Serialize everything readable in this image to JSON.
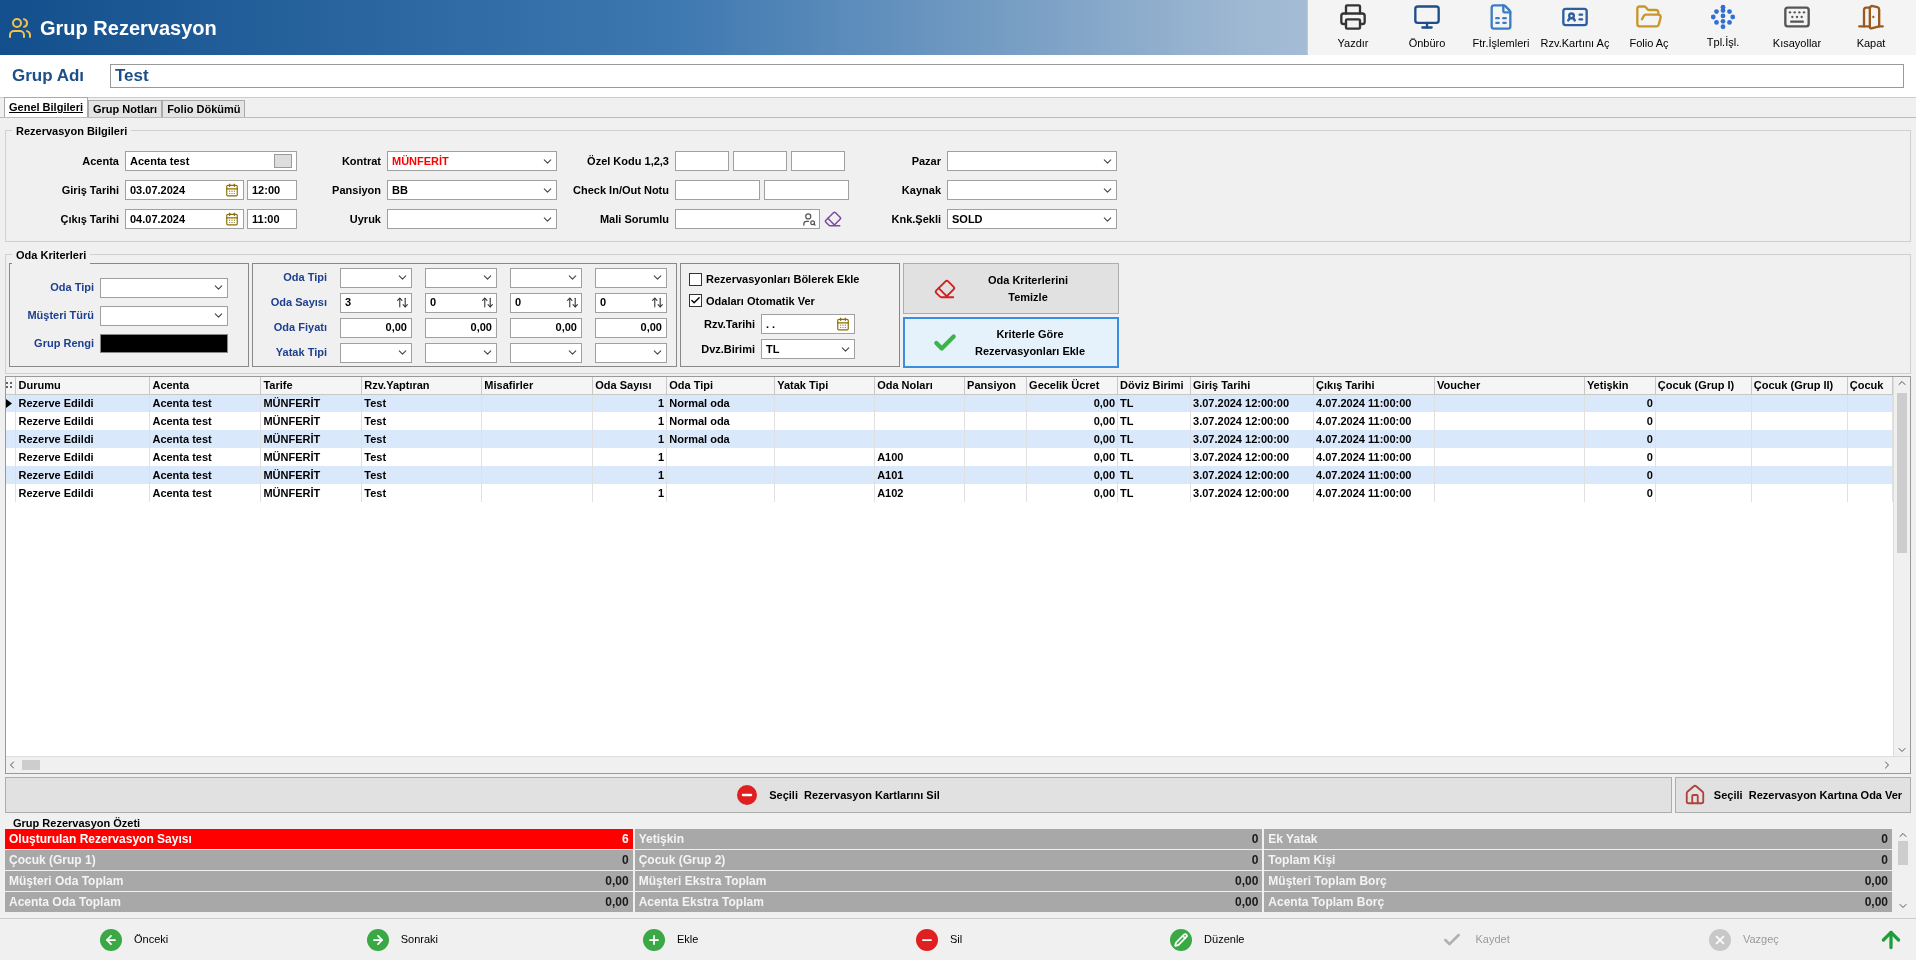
{
  "window": {
    "title": "Grup Rezervasyon"
  },
  "toolbar": [
    {
      "label": "Yazdır"
    },
    {
      "label": "Önbüro"
    },
    {
      "label": "Ftr.İşlemleri"
    },
    {
      "label": "Rzv.Kartını Aç"
    },
    {
      "label": "Folio Aç"
    },
    {
      "label": "Tpl.İşl."
    },
    {
      "label": "Kısayollar"
    },
    {
      "label": "Kapat"
    }
  ],
  "group_name": {
    "label": "Grup Adı",
    "value": "Test"
  },
  "tabs": [
    {
      "label": "Genel Bilgileri",
      "selected": true
    },
    {
      "label": "Grup Notları",
      "selected": false
    },
    {
      "label": "Folio Dökümü",
      "selected": false
    }
  ],
  "reservation_info": {
    "title": "Rezervasyon Bilgileri",
    "columns": [
      [
        {
          "label": "Acenta",
          "kind": "lookup",
          "value": "Acenta test"
        },
        {
          "label": "Giriş Tarihi",
          "kind": "datetime",
          "value": "03.07.2024",
          "time": "12:00"
        },
        {
          "label": "Çıkış Tarihi",
          "kind": "datetime",
          "value": "04.07.2024",
          "time": "11:00"
        }
      ],
      [
        {
          "label": "Kontrat",
          "kind": "select",
          "value": "MÜNFERİT",
          "alert": true
        },
        {
          "label": "Pansiyon",
          "kind": "select",
          "value": "BB",
          "alert": false
        },
        {
          "label": "Uyruk",
          "kind": "select"
        }
      ],
      [
        {
          "label": "Özel Kodu 1,2,3",
          "kind": "triple"
        },
        {
          "label": "Check In/Out Notu",
          "kind": "double"
        },
        {
          "label": "Mali Sorumlu",
          "kind": "person"
        }
      ],
      [
        {
          "label": "Pazar",
          "kind": "select"
        },
        {
          "label": "Kaynak",
          "kind": "select"
        },
        {
          "label": "Knk.Şekli",
          "kind": "select",
          "value": "SOLD",
          "alert": false
        }
      ]
    ]
  },
  "room_criteria": {
    "title": "Oda Kriterleri",
    "left": [
      {
        "label": "Oda Tipi",
        "kind": "select"
      },
      {
        "label": "Müşteri Türü",
        "kind": "select"
      },
      {
        "label": "Grup Rengi",
        "kind": "color",
        "color": "#000000"
      }
    ],
    "grid": [
      {
        "label": "Oda Tipi",
        "cells": [
          {
            "kind": "select"
          },
          {
            "kind": "select"
          },
          {
            "kind": "select"
          },
          {
            "kind": "select"
          }
        ]
      },
      {
        "label": "Oda Sayısı",
        "cells": [
          {
            "kind": "spin",
            "value": "3"
          },
          {
            "kind": "spin",
            "value": "0"
          },
          {
            "kind": "spin",
            "value": "0"
          },
          {
            "kind": "spin",
            "value": "0"
          }
        ]
      },
      {
        "label": "Oda Fiyatı",
        "cells": [
          {
            "kind": "number",
            "value": "0,00"
          },
          {
            "kind": "number",
            "value": "0,00"
          },
          {
            "kind": "number",
            "value": "0,00"
          },
          {
            "kind": "number",
            "value": "0,00"
          }
        ]
      },
      {
        "label": "Yatak Tipi",
        "cells": [
          {
            "kind": "select"
          },
          {
            "kind": "select"
          },
          {
            "kind": "select"
          },
          {
            "kind": "select"
          }
        ]
      }
    ],
    "options": [
      {
        "label": "Rezervasyonları Bölerek Ekle",
        "checked": false
      },
      {
        "label": "Odaları Otomatik Ver",
        "checked": true
      }
    ],
    "fields": [
      {
        "label": "Rzv.Tarihi",
        "kind": "date",
        "value": ". ."
      },
      {
        "label": "Dvz.Birimi",
        "kind": "select",
        "value": "TL"
      }
    ],
    "buttons": [
      {
        "label": "Oda Kriterlerini Temizle",
        "focused": false
      },
      {
        "label": "Kriterle Göre Rezervasyonları Ekle",
        "focused": true
      }
    ]
  },
  "table": {
    "columns": [
      {
        "label": "Durumu",
        "right_aligned": false
      },
      {
        "label": "Acenta",
        "right_aligned": false
      },
      {
        "label": "Tarife",
        "right_aligned": false
      },
      {
        "label": "Rzv.Yaptıran",
        "right_aligned": false
      },
      {
        "label": "Misafirler"
      },
      {
        "label": "Oda Sayısı",
        "right_aligned": true
      },
      {
        "label": "Oda Tipi",
        "right_aligned": false
      },
      {
        "label": "Yatak Tipi"
      },
      {
        "label": "Oda Noları",
        "right_aligned": false
      },
      {
        "label": "Pansiyon"
      },
      {
        "label": "Gecelik Ücret",
        "right_aligned": true
      },
      {
        "label": "Döviz Birimi",
        "right_aligned": false
      },
      {
        "label": "Giriş Tarihi",
        "right_aligned": false
      },
      {
        "label": "Çıkış Tarihi",
        "right_aligned": false
      },
      {
        "label": "Voucher"
      },
      {
        "label": "Yetişkin",
        "right_aligned": true
      },
      {
        "label": "Çocuk (Grup I)"
      },
      {
        "label": "Çocuk (Grup II)"
      },
      {
        "label": "Çocuk"
      }
    ],
    "rows": [
      {
        "selected": true,
        "cells": [
          "Rezerve Edildi",
          "Acenta test",
          "MÜNFERİT",
          "Test",
          null,
          "1",
          "Normal oda",
          null,
          null,
          null,
          "0,00",
          "TL",
          "3.07.2024 12:00:00",
          "4.07.2024 11:00:00",
          null,
          "0",
          null,
          null,
          null
        ]
      },
      {
        "selected": false,
        "cells": [
          "Rezerve Edildi",
          "Acenta test",
          "MÜNFERİT",
          "Test",
          null,
          "1",
          "Normal oda",
          null,
          null,
          null,
          "0,00",
          "TL",
          "3.07.2024 12:00:00",
          "4.07.2024 11:00:00",
          null,
          "0",
          null,
          null,
          null
        ]
      },
      {
        "selected": false,
        "cells": [
          "Rezerve Edildi",
          "Acenta test",
          "MÜNFERİT",
          "Test",
          null,
          "1",
          "Normal oda",
          null,
          null,
          null,
          "0,00",
          "TL",
          "3.07.2024 12:00:00",
          "4.07.2024 11:00:00",
          null,
          "0",
          null,
          null,
          null
        ]
      },
      {
        "selected": false,
        "cells": [
          "Rezerve Edildi",
          "Acenta test",
          "MÜNFERİT",
          "Test",
          null,
          "1",
          null,
          null,
          "A100",
          null,
          "0,00",
          "TL",
          "3.07.2024 12:00:00",
          "4.07.2024 11:00:00",
          null,
          "0",
          null,
          null,
          null
        ]
      },
      {
        "selected": false,
        "cells": [
          "Rezerve Edildi",
          "Acenta test",
          "MÜNFERİT",
          "Test",
          null,
          "1",
          null,
          null,
          "A101",
          null,
          "0,00",
          "TL",
          "3.07.2024 12:00:00",
          "4.07.2024 11:00:00",
          null,
          "0",
          null,
          null,
          null
        ]
      },
      {
        "selected": false,
        "cells": [
          "Rezerve Edildi",
          "Acenta test",
          "MÜNFERİT",
          "Test",
          null,
          "1",
          null,
          null,
          "A102",
          null,
          "0,00",
          "TL",
          "3.07.2024 12:00:00",
          "4.07.2024 11:00:00",
          null,
          "0",
          null,
          null,
          null
        ]
      }
    ]
  },
  "actions": [
    {
      "label": "Seçili  Rezervasyon Kartlarını Sil"
    },
    {
      "label": "Seçili  Rezervasyon Kartına Oda Ver"
    }
  ],
  "summary": {
    "title": "Grup Rezervasyon Özeti",
    "cells": [
      {
        "label": "Oluşturulan Rezervasyon Sayısı",
        "value": "6",
        "alert": true
      },
      {
        "label": "Yetişkin",
        "value": "0",
        "alert": false
      },
      {
        "label": "Ek Yatak",
        "value": "0",
        "alert": false
      },
      {
        "label": "Çocuk (Grup 1)",
        "value": "0",
        "alert": false
      },
      {
        "label": "Çocuk (Grup 2)",
        "value": "0",
        "alert": false
      },
      {
        "label": "Toplam Kişi",
        "value": "0",
        "alert": false
      },
      {
        "label": "Müşteri Oda Toplam",
        "value": "0,00",
        "alert": false
      },
      {
        "label": "Müşteri Ekstra Toplam",
        "value": "0,00",
        "alert": false
      },
      {
        "label": "Müşteri Toplam Borç",
        "value": "0,00",
        "alert": false
      },
      {
        "label": "Acenta Oda Toplam",
        "value": "0,00",
        "alert": false
      },
      {
        "label": "Acenta Ekstra Toplam",
        "value": "0,00",
        "alert": false
      },
      {
        "label": "Acenta Toplam Borç",
        "value": "0,00",
        "alert": false
      }
    ]
  },
  "navigation": [
    {
      "label": "Önceki",
      "disabled": false
    },
    {
      "label": "Sonraki",
      "disabled": false
    },
    {
      "label": "Ekle",
      "disabled": false
    },
    {
      "label": "Sil",
      "disabled": false
    },
    {
      "label": "Düzenle",
      "disabled": false
    },
    {
      "label": "Kaydet",
      "disabled": true
    },
    {
      "label": "Vazgeç",
      "disabled": true
    }
  ]
}
